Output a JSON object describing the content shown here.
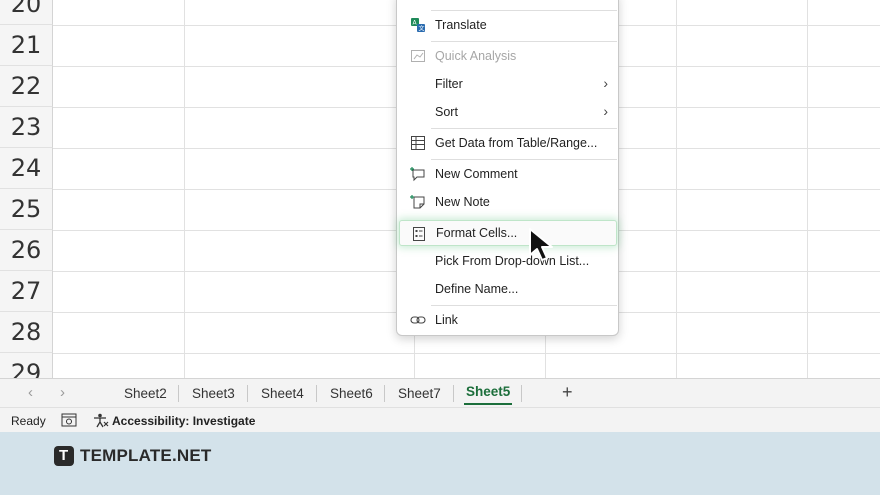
{
  "grid": {
    "row_numbers": [
      "20",
      "21",
      "22",
      "23",
      "24",
      "25",
      "26",
      "27",
      "28",
      "29"
    ]
  },
  "context_menu": {
    "items": [
      {
        "label": "Translate",
        "icon": "translate-icon",
        "disabled": false
      },
      {
        "label": "Quick Analysis",
        "icon": "quick-analysis-icon",
        "disabled": true
      },
      {
        "label": "Filter",
        "icon": "",
        "submenu": true
      },
      {
        "label": "Sort",
        "icon": "",
        "submenu": true
      },
      {
        "label": "Get Data from Table/Range...",
        "icon": "table-icon"
      },
      {
        "label": "New Comment",
        "icon": "comment-icon"
      },
      {
        "label": "New Note",
        "icon": "note-icon"
      },
      {
        "label": "Format Cells...",
        "icon": "format-cells-icon",
        "highlighted": true
      },
      {
        "label": "Pick From Drop-down List...",
        "icon": ""
      },
      {
        "label": "Define Name...",
        "icon": ""
      },
      {
        "label": "Link",
        "icon": "link-icon"
      }
    ],
    "submenu_arrow": "›"
  },
  "sheet_tabs": {
    "prev": "‹",
    "next": "›",
    "tabs": [
      "Sheet2",
      "Sheet3",
      "Sheet4",
      "Sheet6",
      "Sheet7",
      "Sheet5"
    ],
    "active": "Sheet5",
    "add_label": "+"
  },
  "status_bar": {
    "ready": "Ready",
    "accessibility": "Accessibility: Investigate"
  },
  "brand": {
    "logo_text": "TEMPLATE.NET",
    "logo_mark": "T"
  },
  "colors": {
    "accent_green": "#1c6e3b",
    "footer_bg": "#d3e2ea"
  }
}
